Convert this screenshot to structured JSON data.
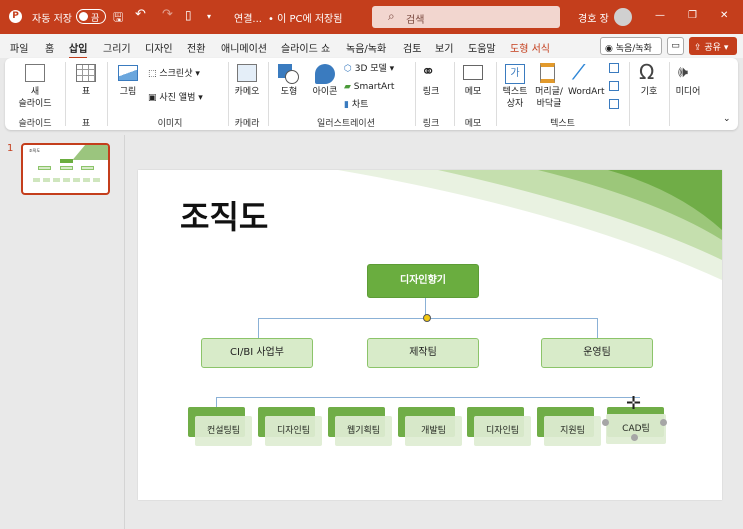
{
  "titlebar": {
    "autosave_label": "자동 저장",
    "autosave_state": "끔",
    "filename": "연결...",
    "save_status": "• 이 PC에 저장됨",
    "search_placeholder": "검색",
    "user": "경호 장",
    "minimize": "—",
    "maximize": "❐",
    "close": "✕"
  },
  "tabs": [
    "파일",
    "홈",
    "삽입",
    "그리기",
    "디자인",
    "전환",
    "애니메이션",
    "슬라이드 쇼",
    "녹음/녹화",
    "검토",
    "보기",
    "도움말",
    "도형 서식"
  ],
  "tab_actions": {
    "record": "녹음/녹화",
    "share": "공유"
  },
  "ribbon": {
    "new_slide": "새\n슬라이드",
    "table": "표",
    "picture": "그림",
    "screenshot": "스크린샷",
    "photo_album": "사진 앨범",
    "cameo": "카메오",
    "shapes": "도형",
    "icons": "아이콘",
    "model3d": "3D 모델",
    "smartart": "SmartArt",
    "chart": "차트",
    "link": "링크",
    "comment": "메모",
    "textbox": "텍스트\n상자",
    "header_footer": "머리글/\n바닥글",
    "wordart": "WordArt",
    "symbol": "기호",
    "media": "미디어",
    "groups": [
      "슬라이드",
      "표",
      "이미지",
      "카메라",
      "일러스트레이션",
      "링크",
      "메모",
      "텍스트"
    ]
  },
  "thumbnail": {
    "number": "1"
  },
  "slide": {
    "title": "조직도",
    "top": "디자인향기",
    "mid": [
      "CI/BI 사업부",
      "제작팀",
      "운영팀"
    ],
    "bottom": [
      "컨설팅팀",
      "디자인팀",
      "웹기획팀",
      "개발팀",
      "디자인팀",
      "지원팀",
      "CAD팀"
    ]
  },
  "colors": {
    "accent": "#c43e1c",
    "green": "#70ad47"
  }
}
